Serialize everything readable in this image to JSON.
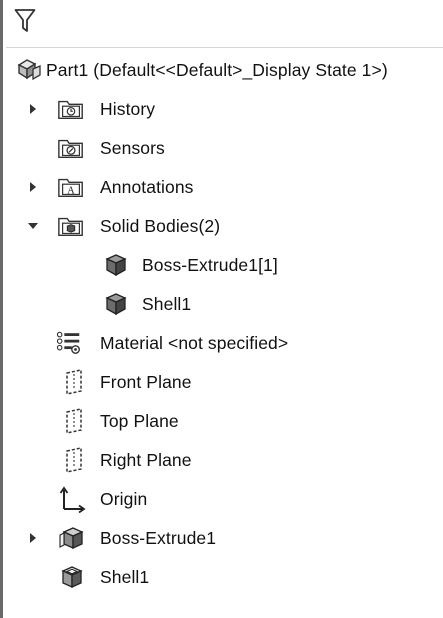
{
  "filter": {
    "icon": "filter-icon"
  },
  "tree": {
    "root": {
      "label": "Part1  (Default<<Default>_Display State 1>)",
      "icon": "part-icon"
    },
    "items": [
      {
        "label": "History",
        "icon": "history-folder-icon",
        "expandable": true,
        "expanded": false
      },
      {
        "label": "Sensors",
        "icon": "sensors-folder-icon",
        "expandable": false
      },
      {
        "label": "Annotations",
        "icon": "annotations-folder-icon",
        "expandable": true,
        "expanded": false
      },
      {
        "label": "Solid Bodies(2)",
        "icon": "solid-bodies-folder-icon",
        "expandable": true,
        "expanded": true
      },
      {
        "label": "Boss-Extrude1[1]",
        "icon": "solid-body-icon",
        "expandable": false
      },
      {
        "label": "Shell1",
        "icon": "solid-body-icon",
        "expandable": false
      },
      {
        "label": "Material <not specified>",
        "icon": "material-icon",
        "expandable": false
      },
      {
        "label": "Front Plane",
        "icon": "plane-icon",
        "expandable": false
      },
      {
        "label": "Top Plane",
        "icon": "plane-icon",
        "expandable": false
      },
      {
        "label": "Right Plane",
        "icon": "plane-icon",
        "expandable": false
      },
      {
        "label": "Origin",
        "icon": "origin-icon",
        "expandable": false
      },
      {
        "label": "Boss-Extrude1",
        "icon": "extrude-feature-icon",
        "expandable": true,
        "expanded": false
      },
      {
        "label": "Shell1",
        "icon": "shell-feature-icon",
        "expandable": false
      }
    ]
  }
}
